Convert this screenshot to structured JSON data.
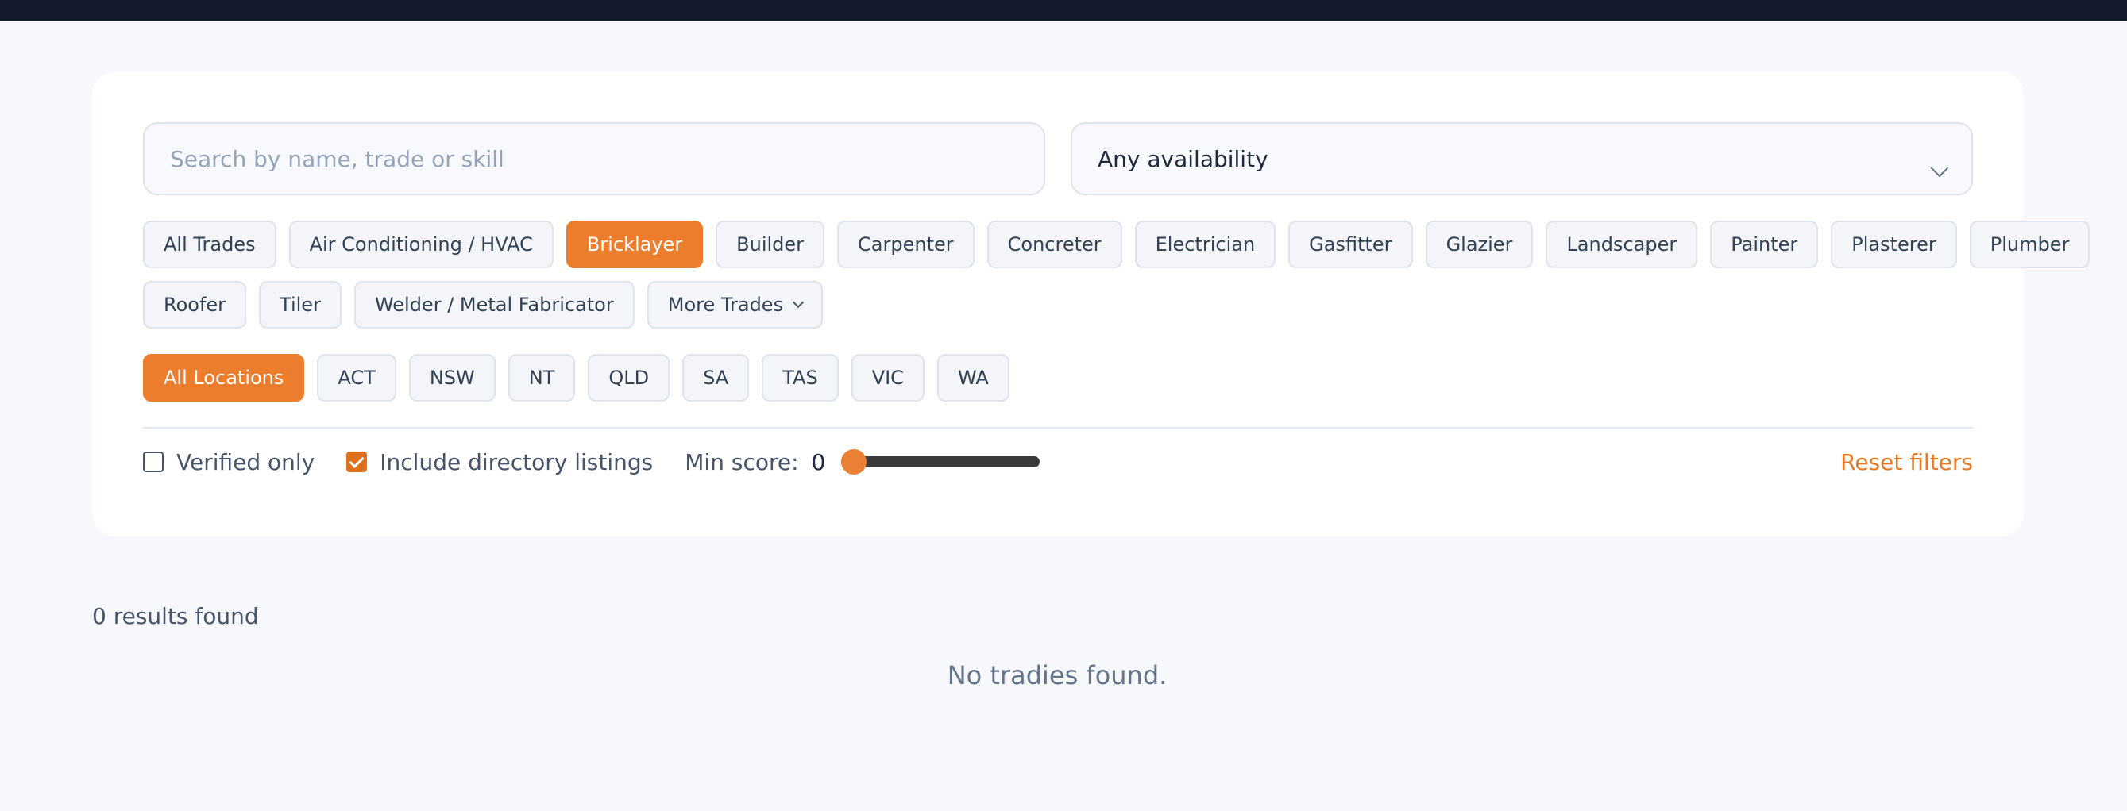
{
  "search": {
    "placeholder": "Search by name, trade or skill",
    "value": ""
  },
  "availability": {
    "selected": "Any availability"
  },
  "trades": {
    "row1": [
      {
        "label": "All Trades",
        "active": false
      },
      {
        "label": "Air Conditioning / HVAC",
        "active": false
      },
      {
        "label": "Bricklayer",
        "active": true
      },
      {
        "label": "Builder",
        "active": false
      },
      {
        "label": "Carpenter",
        "active": false
      },
      {
        "label": "Concreter",
        "active": false
      },
      {
        "label": "Electrician",
        "active": false
      },
      {
        "label": "Gasfitter",
        "active": false
      },
      {
        "label": "Glazier",
        "active": false
      },
      {
        "label": "Landscaper",
        "active": false
      },
      {
        "label": "Painter",
        "active": false
      },
      {
        "label": "Plasterer",
        "active": false
      },
      {
        "label": "Plumber",
        "active": false
      }
    ],
    "row2": [
      {
        "label": "Roofer",
        "active": false
      },
      {
        "label": "Tiler",
        "active": false
      },
      {
        "label": "Welder / Metal Fabricator",
        "active": false
      }
    ],
    "more_label": "More Trades"
  },
  "locations": [
    {
      "label": "All Locations",
      "active": true
    },
    {
      "label": "ACT",
      "active": false
    },
    {
      "label": "NSW",
      "active": false
    },
    {
      "label": "NT",
      "active": false
    },
    {
      "label": "QLD",
      "active": false
    },
    {
      "label": "SA",
      "active": false
    },
    {
      "label": "TAS",
      "active": false
    },
    {
      "label": "VIC",
      "active": false
    },
    {
      "label": "WA",
      "active": false
    }
  ],
  "filters": {
    "verified_label": "Verified only",
    "verified_checked": false,
    "directory_label": "Include directory listings",
    "directory_checked": true,
    "min_score_label": "Min score:",
    "min_score_value": "0",
    "reset_label": "Reset filters"
  },
  "results": {
    "count_text": "0 results found",
    "empty_text": "No tradies found."
  },
  "colors": {
    "accent": "#ec7d2d",
    "topbar": "#141a2b",
    "background": "#f6f8fb"
  },
  "icons": {
    "availability_dropdown": "chevron-down-icon",
    "more_trades": "chevron-down-icon",
    "checkbox_checked": "check-icon"
  }
}
